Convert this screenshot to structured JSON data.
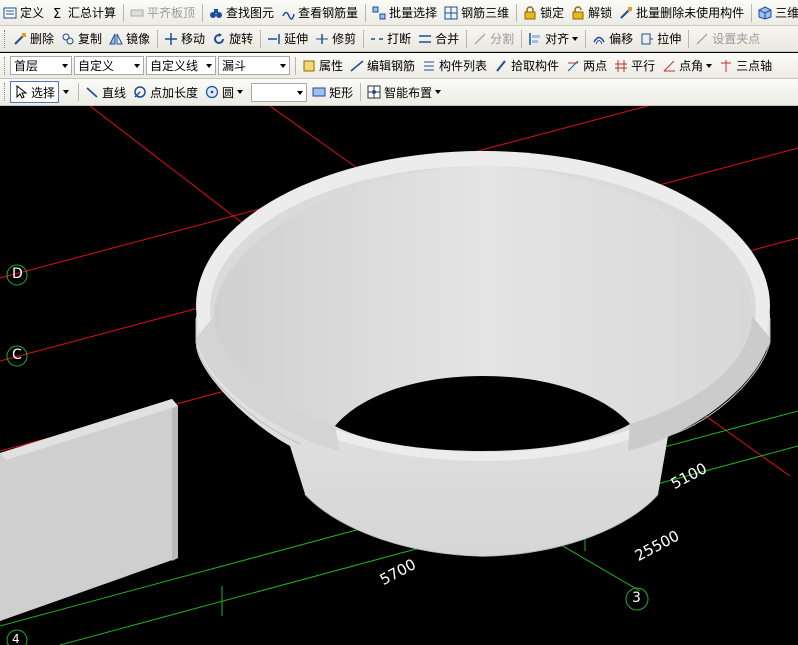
{
  "toolbar1": {
    "items": [
      {
        "label": "定义",
        "icon": "define-icon",
        "enabled": true
      },
      {
        "label": "汇总计算",
        "icon": "sigma-icon",
        "enabled": true
      },
      {
        "label": "平齐板顶",
        "icon": "align-slab-top-icon",
        "enabled": false
      },
      {
        "label": "查找图元",
        "icon": "binoculars-icon",
        "enabled": true
      },
      {
        "label": "查看钢筋量",
        "icon": "rebar-view-icon",
        "enabled": true
      },
      {
        "label": "批量选择",
        "icon": "batch-select-icon",
        "enabled": true
      },
      {
        "label": "钢筋三维",
        "icon": "rebar-3d-icon",
        "enabled": true
      },
      {
        "label": "锁定",
        "icon": "lock-icon",
        "enabled": true
      },
      {
        "label": "解锁",
        "icon": "unlock-icon",
        "enabled": true
      },
      {
        "label": "批量删除未使用构件",
        "icon": "batch-delete-icon",
        "enabled": true
      },
      {
        "label": "三维",
        "icon": "cube-3d-icon",
        "enabled": true
      }
    ]
  },
  "toolbar2": {
    "items": [
      {
        "label": "删除",
        "icon": "delete-icon",
        "enabled": true
      },
      {
        "label": "复制",
        "icon": "copy-icon",
        "enabled": true
      },
      {
        "label": "镜像",
        "icon": "mirror-icon",
        "enabled": true
      },
      {
        "label": "移动",
        "icon": "move-icon",
        "enabled": true
      },
      {
        "label": "旋转",
        "icon": "rotate-icon",
        "enabled": true
      },
      {
        "label": "延伸",
        "icon": "extend-icon",
        "enabled": true
      },
      {
        "label": "修剪",
        "icon": "trim-icon",
        "enabled": true
      },
      {
        "label": "打断",
        "icon": "break-icon",
        "enabled": true
      },
      {
        "label": "合并",
        "icon": "merge-icon",
        "enabled": true
      },
      {
        "label": "分割",
        "icon": "split-icon",
        "enabled": false
      },
      {
        "label": "对齐",
        "icon": "align-icon",
        "enabled": true,
        "dropdown": true
      },
      {
        "label": "偏移",
        "icon": "offset-icon",
        "enabled": true
      },
      {
        "label": "拉伸",
        "icon": "stretch-icon",
        "enabled": true
      },
      {
        "label": "设置夹点",
        "icon": "grip-point-icon",
        "enabled": false
      }
    ]
  },
  "toolbar3": {
    "floor": "首层",
    "category": "自定义",
    "subcategory": "自定义线",
    "component": "漏斗",
    "items": [
      {
        "label": "属性",
        "icon": "properties-icon"
      },
      {
        "label": "编辑钢筋",
        "icon": "edit-rebar-icon"
      },
      {
        "label": "构件列表",
        "icon": "component-list-icon"
      },
      {
        "label": "拾取构件",
        "icon": "pick-component-icon"
      },
      {
        "label": "两点",
        "icon": "two-point-icon"
      },
      {
        "label": "平行",
        "icon": "parallel-icon"
      },
      {
        "label": "点角",
        "icon": "point-angle-icon",
        "dropdown": true
      },
      {
        "label": "三点轴",
        "icon": "three-point-axis-icon"
      }
    ]
  },
  "toolbar4": {
    "select_label": "选择",
    "line_label": "直线",
    "add_length_label": "点加长度",
    "circle_label": "圆",
    "circle_value": "",
    "rect_label": "矩形",
    "smart_layout_label": "智能布置"
  },
  "viewport": {
    "axis_labels": [
      "D",
      "C",
      "3",
      "4"
    ],
    "dimensions": [
      "5700",
      "25500",
      "5100"
    ],
    "colors": {
      "background": "#000000",
      "grid_red": "#e01010",
      "grid_green": "#20b020",
      "funnel": "#e6e6e6",
      "wall": "#cfcfcf"
    }
  }
}
